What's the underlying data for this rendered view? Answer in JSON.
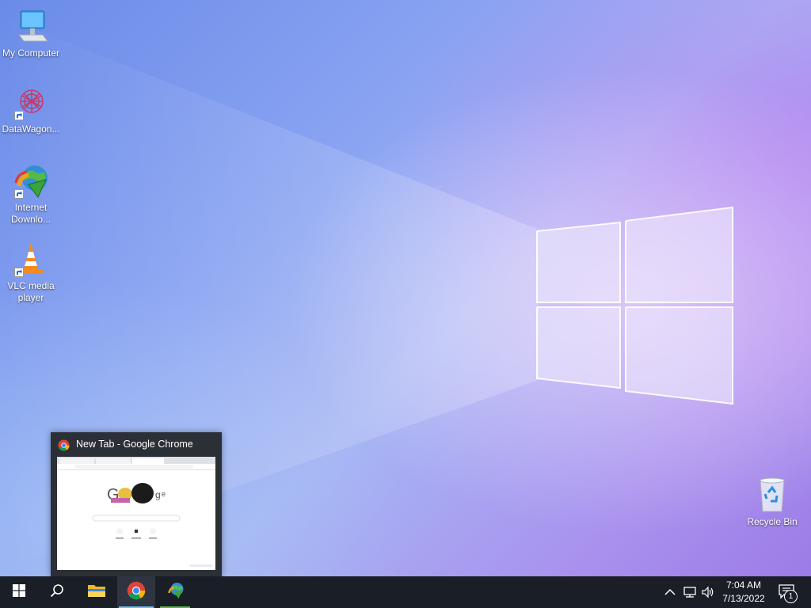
{
  "desktop": {
    "icons": [
      {
        "label_line1": "My Computer",
        "label_line2": "",
        "icon": "computer-icon"
      },
      {
        "label_line1": "DataWagon...",
        "label_line2": "",
        "icon": "datawagon-icon"
      },
      {
        "label_line1": "Internet",
        "label_line2": "Downlo...",
        "icon": "internet-download-manager-icon"
      },
      {
        "label_line1": "VLC media",
        "label_line2": "player",
        "icon": "vlc-cone-icon"
      },
      {
        "label_line1": "Recycle Bin",
        "label_line2": "",
        "icon": "recycle-bin-icon"
      }
    ]
  },
  "preview": {
    "title": "New Tab - Google Chrome",
    "icon": "chrome-icon"
  },
  "taskbar": {
    "buttons": [
      "start-windows-icon",
      "search-icon",
      "file-explorer-icon",
      "chrome-icon",
      "internet-download-manager-icon"
    ],
    "tray": {
      "time": "7:04 AM",
      "date": "7/13/2022",
      "notification_count": "1",
      "icons": [
        "chevron-up-icon",
        "network-icon",
        "volume-icon",
        "notification-icon"
      ]
    }
  },
  "colors": {
    "taskbar": "#1a1e26",
    "active_indicator": "#76b9ed",
    "preview_bg": "#2b2f36"
  }
}
